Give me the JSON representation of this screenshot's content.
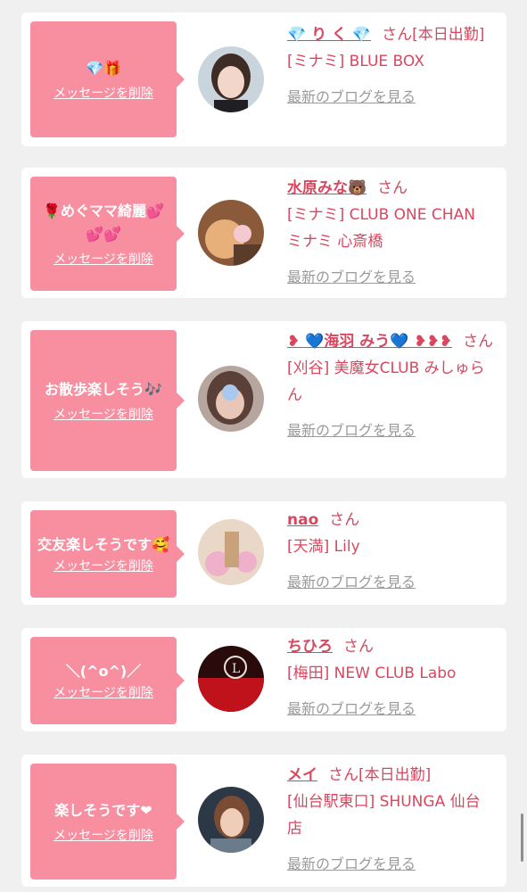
{
  "messages": [
    {
      "message": "💎🎁",
      "delete_label": "メッセージを削除",
      "name": "💎 り く 💎",
      "honorific": "さん[本日出勤]",
      "shop": "[ミナミ] BLUE BOX",
      "blog_label": "最新のブログを見る",
      "avatar_colors": [
        "#c9d4dc",
        "#3e2d24",
        "#f2d6c9"
      ]
    },
    {
      "message": "🌹めぐママ綺麗💕💕💕",
      "delete_label": "メッセージを削除",
      "name": "水原みな🐻",
      "honorific": "さん",
      "shop": "[ミナミ] CLUB ONE CHAN ミナミ 心斎橋",
      "blog_label": "最新のブログを見る",
      "avatar_colors": [
        "#e7b07a",
        "#f4c9d2",
        "#8a5a3a"
      ]
    },
    {
      "message": "お散歩楽しそう🎶",
      "delete_label": "メッセージを削除",
      "name": "❥ 💙海羽 みう💙 ❥❥❥",
      "honorific": "さん",
      "shop": "[刈谷] 美魔女CLUB みしゅらん",
      "blog_label": "最新のブログを見る",
      "avatar_colors": [
        "#b7a6a0",
        "#5a4038",
        "#a9c8ee"
      ]
    },
    {
      "message": "交友楽しそうです🥰",
      "delete_label": "メッセージを削除",
      "name": "nao",
      "honorific": "さん",
      "shop": "[天満] Lily",
      "blog_label": "最新のブログを見る",
      "avatar_colors": [
        "#e9d8c8",
        "#efb1c9",
        "#c7a27a"
      ]
    },
    {
      "message": "＼(^o^)／",
      "delete_label": "メッセージを削除",
      "name": "ちひろ",
      "honorific": "さん",
      "shop": "[梅田] NEW CLUB Labo",
      "blog_label": "最新のブログを見る",
      "avatar_colors": [
        "#c0121b",
        "#2a0b0b",
        "#e9e2da"
      ]
    },
    {
      "message": "楽しそうです❤",
      "delete_label": "メッセージを削除",
      "name": "メイ",
      "honorific": "さん[本日出勤]",
      "shop": "[仙台駅東口] SHUNGA 仙台店",
      "blog_label": "最新のブログを見る",
      "avatar_colors": [
        "#2c3846",
        "#f0cdb8",
        "#7a4c33"
      ]
    }
  ]
}
